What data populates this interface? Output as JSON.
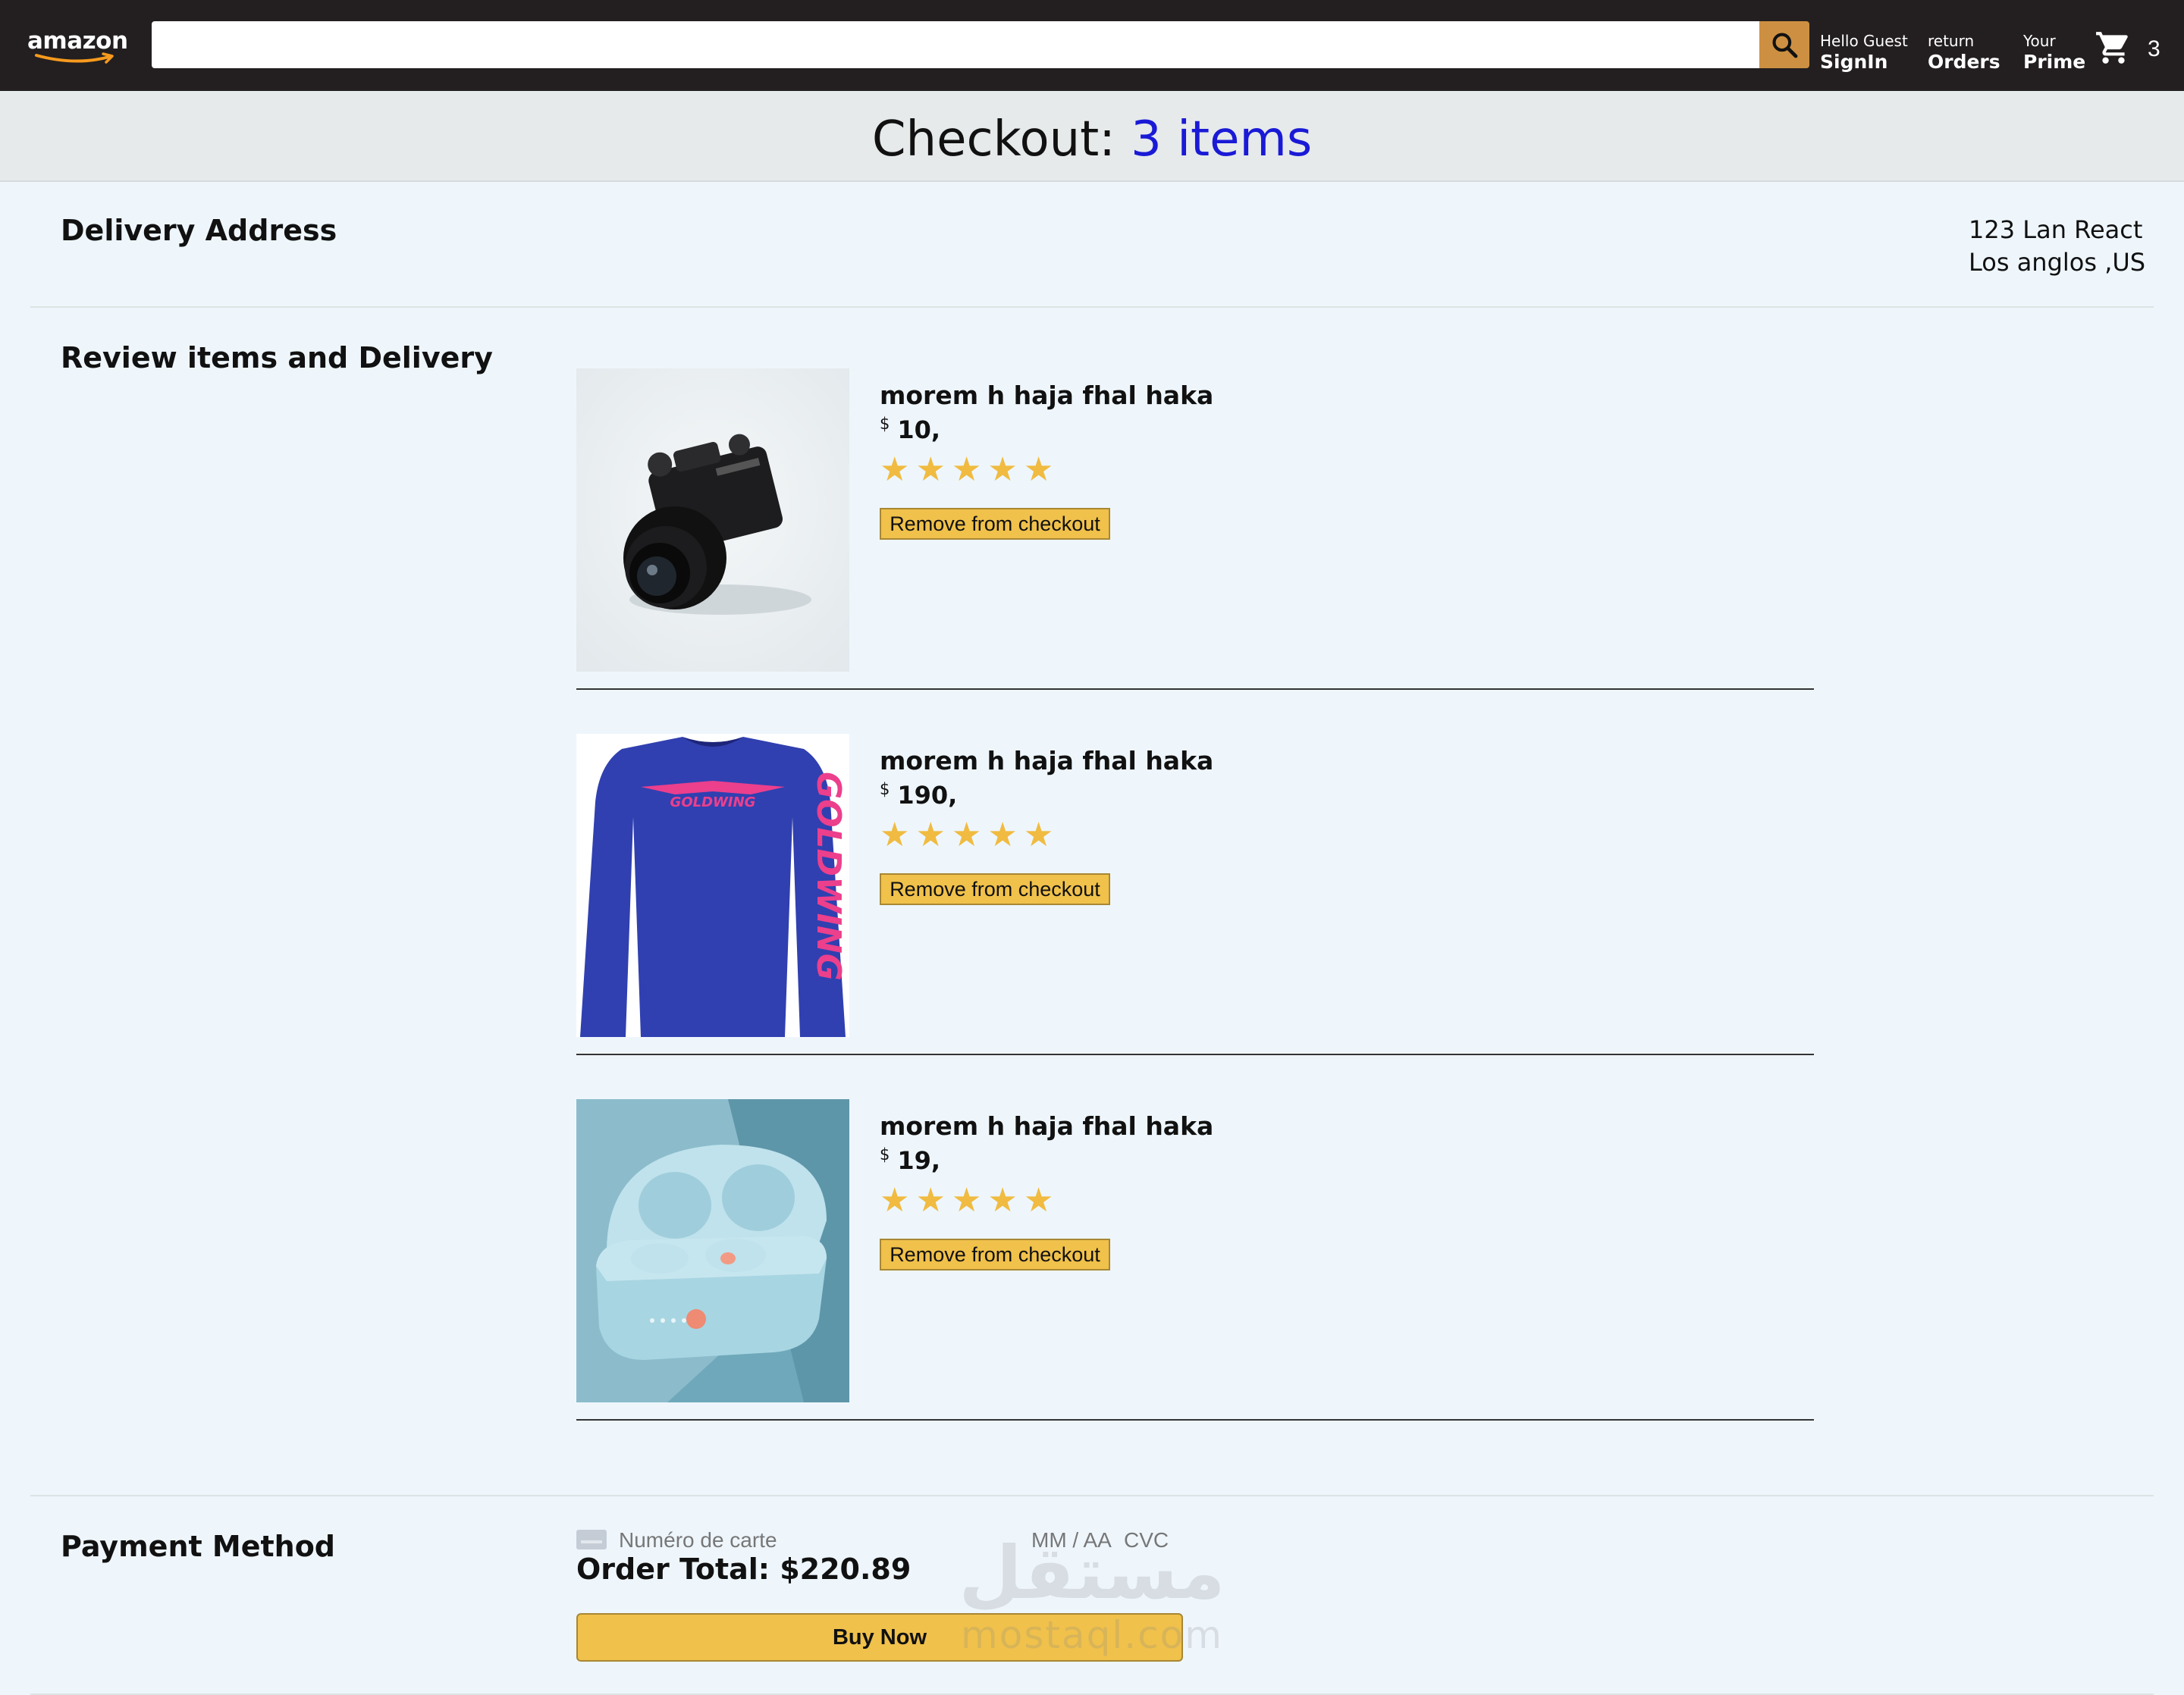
{
  "header": {
    "logo_text": "amazon",
    "search": {
      "value": "",
      "placeholder": ""
    },
    "nav": [
      {
        "line1": "Hello Guest",
        "line2": "SignIn"
      },
      {
        "line1": "return",
        "line2": "Orders"
      },
      {
        "line1": "Your",
        "line2": "Prime"
      }
    ],
    "basket_count": "3",
    "accent_color": "#cd9042",
    "bg_color": "#231f20"
  },
  "checkout": {
    "title_prefix": "Checkout: ",
    "title_count": "3 items"
  },
  "delivery": {
    "title": "Delivery Address",
    "address_line1": "123 Lan React",
    "address_line2": "Los anglos ,US"
  },
  "review": {
    "title": "Review items and Delivery",
    "items": [
      {
        "title": "morem h haja fhal haka",
        "currency": "$",
        "price": "10,",
        "rating": 5,
        "remove_label": "Remove from checkout",
        "image": "camera-image"
      },
      {
        "title": "morem h haja fhal haka",
        "currency": "$",
        "price": "190,",
        "rating": 5,
        "remove_label": "Remove from checkout",
        "image": "shirt-image"
      },
      {
        "title": "morem h haja fhal haka",
        "currency": "$",
        "price": "19,",
        "rating": 5,
        "remove_label": "Remove from checkout",
        "image": "earbuds-image"
      }
    ]
  },
  "payment": {
    "title": "Payment Method",
    "card_placeholder": "Numéro de carte",
    "exp_placeholder": "MM / AA",
    "cvc_placeholder": "CVC",
    "order_total_label": "Order Total: $220.89",
    "buy_label": "Buy Now"
  },
  "watermark": {
    "arabic": "مستقل",
    "latin": "mostaql.com"
  }
}
